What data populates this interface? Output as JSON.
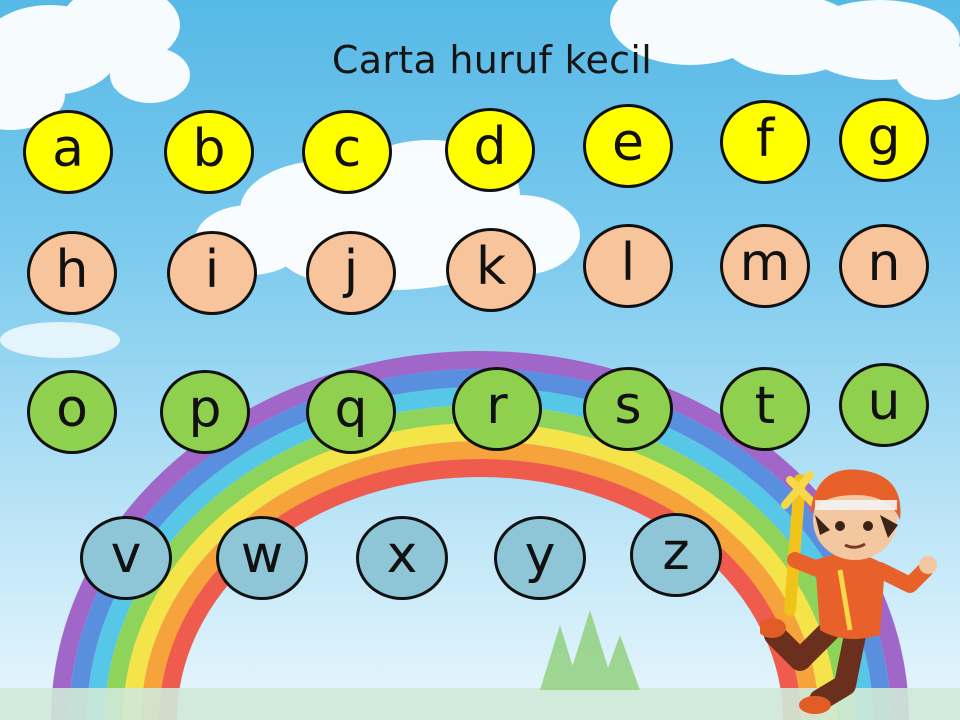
{
  "title": "Carta huruf kecil",
  "colors": {
    "row1": "#ffff00",
    "row2": "#f8c49b",
    "row3": "#8fd14f",
    "row4": "#8ec6d8",
    "border": "#111111"
  },
  "rows": [
    {
      "color_key": "row1",
      "letters": [
        "a",
        "b",
        "c",
        "d",
        "e",
        "f",
        "g"
      ]
    },
    {
      "color_key": "row2",
      "letters": [
        "h",
        "i",
        "j",
        "k",
        "l",
        "m",
        "n"
      ]
    },
    {
      "color_key": "row3",
      "letters": [
        "o",
        "p",
        "q",
        "r",
        "s",
        "t",
        "u"
      ]
    },
    {
      "color_key": "row4",
      "letters": [
        "v",
        "w",
        "x",
        "y",
        "z"
      ]
    }
  ],
  "decorations": [
    "cloud",
    "rainbow",
    "trees",
    "cartoon-boy"
  ]
}
